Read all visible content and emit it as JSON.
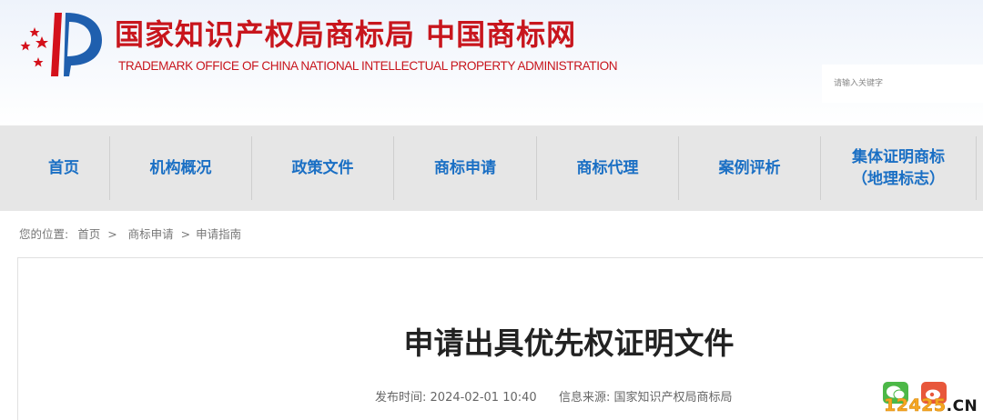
{
  "header": {
    "title": "国家知识产权局商标局 中国商标网",
    "subtitle": "TRADEMARK OFFICE OF CHINA NATIONAL INTELLECTUAL PROPERTY ADMINISTRATION",
    "search_placeholder": "请输入关键字"
  },
  "nav": {
    "items": [
      {
        "label": "首页"
      },
      {
        "label": "机构概况"
      },
      {
        "label": "政策文件"
      },
      {
        "label": "商标申请"
      },
      {
        "label": "商标代理"
      },
      {
        "label": "案例评析"
      },
      {
        "label_line1": "集体证明商标",
        "label_line2": "（地理标志）"
      }
    ]
  },
  "breadcrumb": {
    "prefix": "您的位置:",
    "items": [
      "首页",
      "商标申请",
      "申请指南"
    ],
    "separator": ">"
  },
  "article": {
    "title": "申请出具优先权证明文件",
    "publish_label": "发布时间:",
    "publish_time": "2024-02-01 10:40",
    "source_label": "信息来源:",
    "source": "国家知识产权局商标局"
  },
  "watermark": {
    "number": "12425",
    "suffix": ".CN"
  },
  "colors": {
    "brand_red": "#c8161d",
    "nav_blue": "#1a6fc4",
    "nav_bg": "#e6e6e6"
  }
}
